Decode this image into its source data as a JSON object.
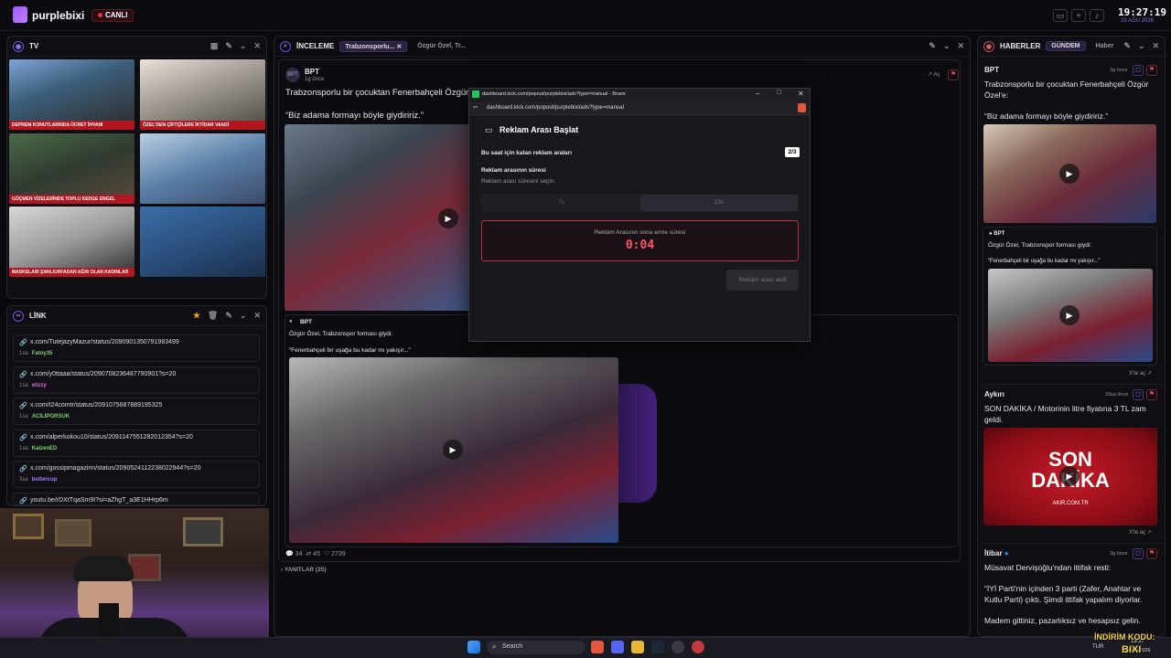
{
  "brand": {
    "name": "purplebixi",
    "live": "CANLI"
  },
  "clock": {
    "time": "19:27:19",
    "date": "22 AĞU 2026"
  },
  "tv": {
    "title": "TV",
    "tickers": [
      "DEPREM KONUTLARINDA ÜCRET İHVANI",
      "ÖZEL'DEN ÇİFTÇİLERE İKTİDAR VAADİ",
      "GÖÇMEN VİZELERİNDE TOPLU KEDGE ENGEL",
      "",
      "MASKELARI ŞANLIURFADAN AĞIR OLAN KADINLAR",
      ""
    ]
  },
  "link": {
    "title": "LİNK",
    "items": [
      {
        "url": "x.com/TutejazyMazur/status/2090901350791983499",
        "age": "1sa",
        "user": "Fatoy35",
        "color": "green"
      },
      {
        "url": "x.com/y0ttaaa/status/2090708236487790901?s=20",
        "age": "1sa",
        "user": "elizzy",
        "color": "pink"
      },
      {
        "url": "x.com/t24comtr/status/2091075687889195325",
        "age": "1sa",
        "user": "ACILIPORSUK",
        "color": "green"
      },
      {
        "url": "x.com/alperkokou10/status/2091147551282012354?s=20",
        "age": "1sa",
        "user": "KaizenED",
        "color": "green"
      },
      {
        "url": "x.com/gossipmagazinn/status/2090524112238022944?s=20",
        "age": "3sa",
        "user": "buttercup",
        "color": "purp"
      },
      {
        "url": "youtu.be/rDXtTqaSm9I?si=aZhgT_a3E1HHrp6m",
        "age": "",
        "user": "",
        "color": "green"
      }
    ]
  },
  "inceleme": {
    "title": "İNCELEME",
    "chip": "Trabzonsporlu...",
    "chip2": "Özgür Özel, Tr...",
    "author": "BPT",
    "ago": "1g önce",
    "open": "Aç",
    "text1": "Trabzonsporlu bir çocuktan Fenerbahçeli Özgür",
    "text2": "“Biz adama formayı böyle giydiririz.”",
    "quote_author": "BPT",
    "quote1": "Özgür Özel, Trabzonspor forması giydi:",
    "quote2": "“Fenerbahçeli bir uşağa bu kadar mı yakışır...”",
    "likes": "34",
    "retweets": "45",
    "views": "2739",
    "replies": "YANITLAR (25)"
  },
  "popup": {
    "titlebar": "dashboard.kick.com/popout/purplebixi/ads?type=manual - Brave",
    "url": "dashboard.kick.com/popout/purplebixi/ads?type=manual",
    "heading": "Reklam Arası Başlat",
    "remaining_label": "Bu saat için kalan reklam araları",
    "remaining": "2/3",
    "dur_label": "Reklam arasının süresi",
    "dur_sub": "Reklam arası süresini seçin.",
    "opt1": "7s",
    "opt2": "15s",
    "timer_label": "Reklam Arasının sona erme süresi",
    "timer": "0:04",
    "active": "Reklam arası aktif"
  },
  "haberler": {
    "title": "HABERLER",
    "chip": "GÜNDEM",
    "chip2": "Haber",
    "n1": {
      "author": "BPT",
      "ago": "2g önce",
      "l1": "Trabzonsporlu bir çocuktan Fenerbahçeli Özgür",
      "l2": "Özel'e:",
      "l3": "“Biz adama formayı böyle giydiririz.”"
    },
    "n1q": {
      "author": "BPT",
      "l1": "Özgür Özel, Trabzonspor forması giydi:",
      "l2": "“Fenerbahçeli bir uşağa bu kadar mı yakışır...”",
      "open": "X'te aç"
    },
    "n2": {
      "author": "Aykırı",
      "ago": "33sa önce",
      "l1": "SON DAKİKA / Motorinin litre fiyatına 3 TL zam",
      "l2": "geldi.",
      "img1": "SON",
      "img2": "DAKİKA",
      "img3": "AKIR.COM.TR",
      "open": "X'te aç"
    },
    "n3": {
      "author": "İtibar",
      "ago": "2g önce",
      "l1": "Müsavat Dervişoğlu'ndan ittifak resti:",
      "l2": "“İYİ Parti'nin içinden 3 parti (Zafer, Anahtar ve",
      "l3": "Kutlu Parti) çıktı. Şimdi ittifak yapalım diyorlar.",
      "l4": "Madem gittiniz, pazarlıksız ve hesapsız gelin."
    }
  },
  "taskbar": {
    "search": "Search",
    "lang": "TUR",
    "time": "19:27",
    "date": "22.08.2026"
  },
  "overlay": {
    "l1": "İNDİRİM KODU:",
    "l2": "BIXI"
  }
}
